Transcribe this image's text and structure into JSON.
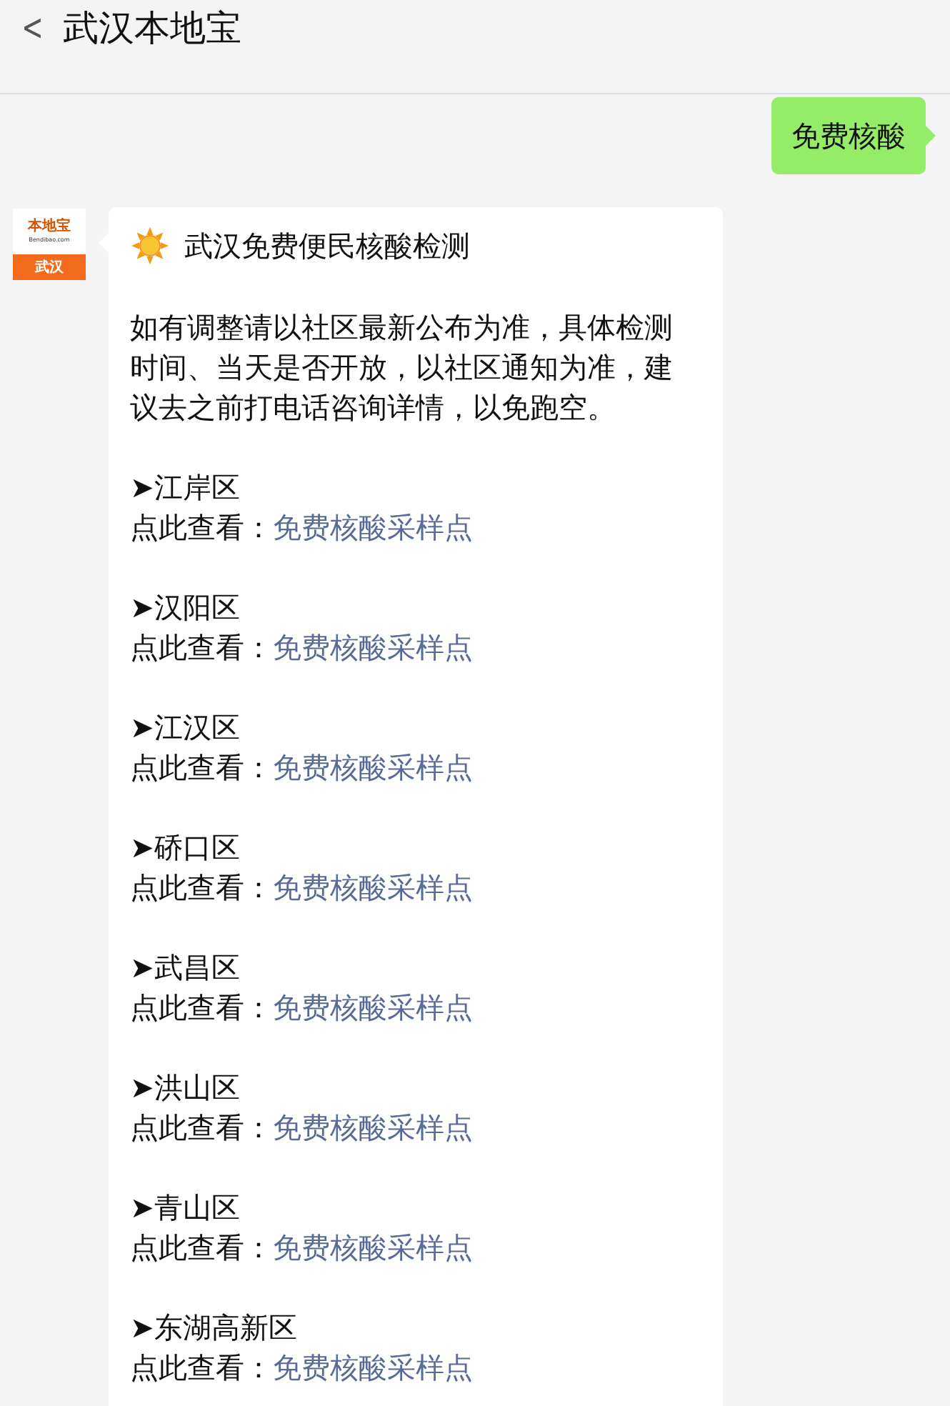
{
  "header": {
    "back": "<",
    "title": "武汉本地宝"
  },
  "messages": [
    {
      "kind": "outgoing",
      "text": "免费核酸"
    },
    {
      "kind": "incoming",
      "avatar": {
        "logo": "本地宝",
        "site": "Bendibao.com",
        "city": "武汉"
      },
      "title": "武汉免费便民核酸检测",
      "intro": "如有调整请以社区最新公布为准，具体检测时间、当天是否开放，以社区通知为准，建议去之前打电话咨询详情，以免跑空。",
      "districts": [
        {
          "name": "➤江岸区",
          "prompt": "点此查看：",
          "link": "免费核酸采样点"
        },
        {
          "name": "➤汉阳区",
          "prompt": "点此查看：",
          "link": "免费核酸采样点"
        },
        {
          "name": "➤江汉区",
          "prompt": "点此查看：",
          "link": "免费核酸采样点"
        },
        {
          "name": "➤硚口区",
          "prompt": "点此查看：",
          "link": "免费核酸采样点"
        },
        {
          "name": "➤武昌区",
          "prompt": "点此查看：",
          "link": "免费核酸采样点"
        },
        {
          "name": "➤洪山区",
          "prompt": "点此查看：",
          "link": "免费核酸采样点"
        },
        {
          "name": "➤青山区",
          "prompt": "点此查看：",
          "link": "免费核酸采样点"
        },
        {
          "name": "➤东湖高新区",
          "prompt": "点此查看：",
          "link": "免费核酸采样点"
        }
      ]
    }
  ]
}
